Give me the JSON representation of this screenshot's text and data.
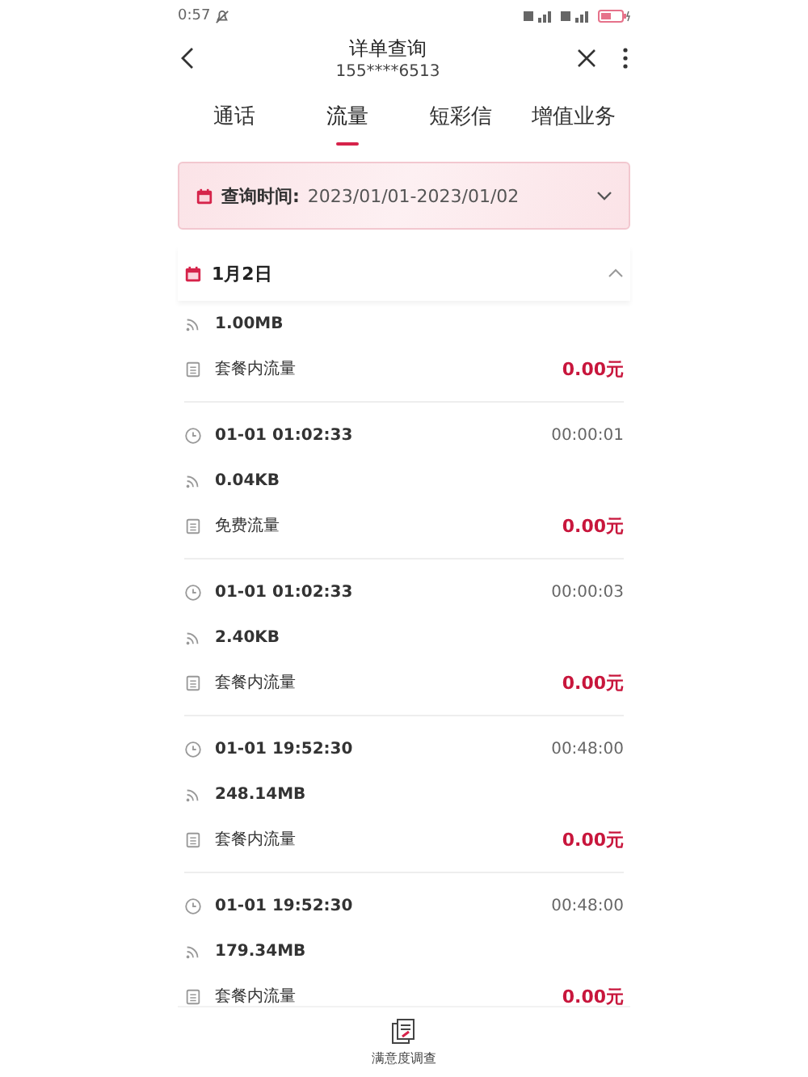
{
  "status_bar": {
    "time": "0:57"
  },
  "header": {
    "title": "详单查询",
    "subtitle": "155****6513"
  },
  "tabs": [
    {
      "label": "通话",
      "selected": false
    },
    {
      "label": "流量",
      "selected": true
    },
    {
      "label": "短彩信",
      "selected": false
    },
    {
      "label": "增值业务",
      "selected": false
    }
  ],
  "query": {
    "label": "查询时间:",
    "value": "2023/01/01-2023/01/02"
  },
  "day": {
    "label": "1月2日",
    "expanded": true
  },
  "records": [
    {
      "volume": "1.00MB",
      "type": "套餐内流量",
      "fee": "0.00元"
    },
    {
      "time": "01-01 01:02:33",
      "duration": "00:00:01",
      "volume": "0.04KB",
      "type": "免费流量",
      "fee": "0.00元"
    },
    {
      "time": "01-01 01:02:33",
      "duration": "00:00:03",
      "volume": "2.40KB",
      "type": "套餐内流量",
      "fee": "0.00元"
    },
    {
      "time": "01-01 19:52:30",
      "duration": "00:48:00",
      "volume": "248.14MB",
      "type": "套餐内流量",
      "fee": "0.00元"
    },
    {
      "time": "01-01 19:52:30",
      "duration": "00:48:00",
      "volume": "179.34MB",
      "type": "套餐内流量",
      "fee": "0.00元"
    }
  ],
  "bottom": {
    "label": "满意度调查"
  }
}
